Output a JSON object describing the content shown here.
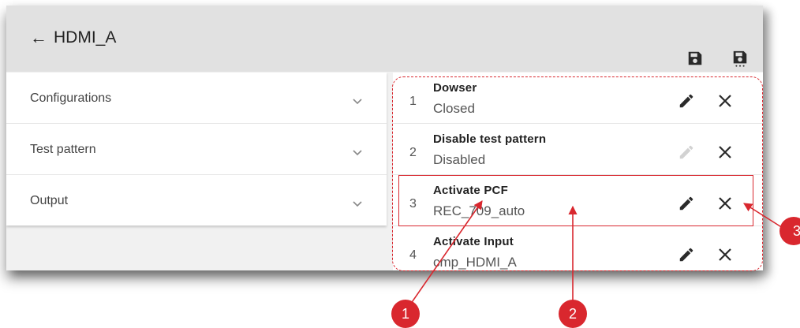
{
  "header": {
    "back_icon": "←",
    "title": "HDMI_A",
    "icons": [
      "save-icon",
      "save-as-icon"
    ]
  },
  "left_panel": {
    "sections": [
      {
        "label": "Configurations"
      },
      {
        "label": "Test pattern"
      },
      {
        "label": "Output"
      }
    ]
  },
  "steps": [
    {
      "number": "1",
      "title": "Dowser",
      "value": "Closed",
      "edit_enabled": true
    },
    {
      "number": "2",
      "title": "Disable test pattern",
      "value": "Disabled",
      "edit_enabled": false
    },
    {
      "number": "3",
      "title": "Activate PCF",
      "value": "REC_709_auto",
      "edit_enabled": true
    },
    {
      "number": "4",
      "title": "Activate Input",
      "value": "cmp_HDMI_A",
      "edit_enabled": true
    }
  ],
  "callouts": [
    "1",
    "2",
    "3"
  ],
  "colors": {
    "accent": "#d9272e",
    "header_bg": "#e1e1e1",
    "disabled_icon": "#cfcfcf"
  }
}
